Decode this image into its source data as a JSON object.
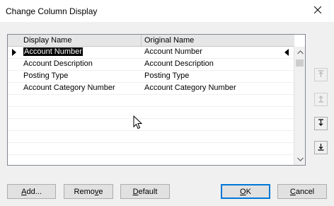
{
  "window": {
    "title": "Change Column Display"
  },
  "grid": {
    "columns": [
      "Display Name",
      "Original Name"
    ],
    "rows": [
      {
        "display": "Account Number",
        "original": "Account Number"
      },
      {
        "display": "Account Description",
        "original": "Account Description"
      },
      {
        "display": "Posting Type",
        "original": "Posting Type"
      },
      {
        "display": "Account Category Number",
        "original": "Account Category Number"
      }
    ]
  },
  "buttons": {
    "add": {
      "pre": "",
      "mn": "A",
      "post": "dd..."
    },
    "remove": {
      "pre": "Remo",
      "mn": "v",
      "post": "e"
    },
    "default": {
      "pre": "",
      "mn": "D",
      "post": "efault"
    },
    "ok": {
      "pre": "",
      "mn": "O",
      "post": "K"
    },
    "cancel": {
      "pre": "",
      "mn": "C",
      "post": "ancel"
    }
  },
  "icons": {
    "close": "close-icon",
    "move_top": "move-to-top-icon",
    "move_up": "move-up-icon",
    "move_down": "move-down-icon",
    "move_bottom": "move-to-bottom-icon"
  }
}
